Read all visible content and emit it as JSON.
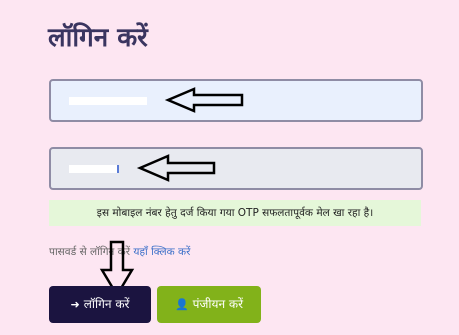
{
  "page": {
    "title": "लॉगिन करें"
  },
  "form": {
    "mobile_value": "",
    "otp_value": ""
  },
  "messages": {
    "success": "इस मोबाइल नंबर हेतु दर्ज किया गया OTP सफलतापूर्वक मेल खा रहा है।"
  },
  "alt_login": {
    "prefix": "पासवर्ड से लॉगिन करें",
    "link": "यहाँ क्लिक करें"
  },
  "buttons": {
    "login": "लॉगिन करें",
    "register": "पंजीयन करें",
    "login_icon": "sign-in-icon",
    "register_icon": "user-icon"
  },
  "colors": {
    "background": "#fde6f2",
    "title": "#3a3560",
    "login_button": "#1b1440",
    "register_button": "#82b21a",
    "success_bg": "#e5f7d9",
    "link": "#3b6fc8"
  }
}
